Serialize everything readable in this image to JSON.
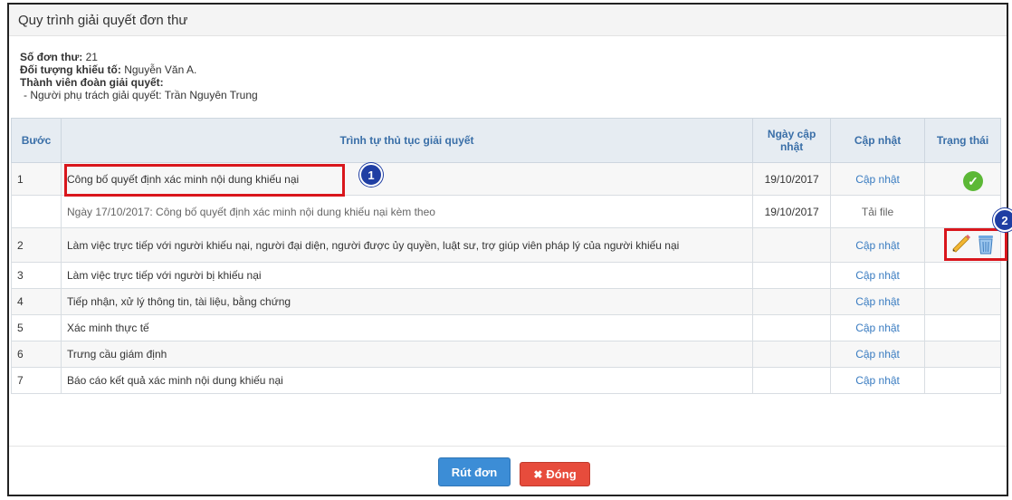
{
  "dialog": {
    "title": "Quy trình giải quyết đơn thư"
  },
  "info": {
    "so_don_thu_label": "Số đơn thư:",
    "so_don_thu_value": "21",
    "doi_tuong_label": "Đối tượng khiếu tố:",
    "doi_tuong_value": "Nguyễn Văn A.",
    "thanh_vien_label": "Thành viên đoàn giải quyết:",
    "phu_trach": "- Người phụ trách giải quyết: Trần Nguyên Trung"
  },
  "table": {
    "headers": [
      "Bước",
      "Trình tự thủ tục giải quyết",
      "Ngày cập nhật",
      "Cập nhật",
      "Trạng thái"
    ],
    "rows": [
      {
        "step": "1",
        "procedure": "Công bố quyết định xác minh nội dung khiếu nại",
        "date": "19/10/2017",
        "action": "Cập nhật",
        "status": "done"
      },
      {
        "step": "",
        "procedure": "Ngày 17/10/2017: Công bố quyết định xác minh nội dung khiếu nại kèm theo",
        "date": "19/10/2017",
        "action": "Tải file",
        "status": "edit-delete"
      },
      {
        "step": "2",
        "procedure": "Làm việc trực tiếp với người khiếu nại, người đại diện, người được ủy quyền, luật sư, trợ giúp viên pháp lý của người khiếu nại",
        "date": "",
        "action": "Cập nhật",
        "status": ""
      },
      {
        "step": "3",
        "procedure": "Làm việc trực tiếp với người bị khiếu nại",
        "date": "",
        "action": "Cập nhật",
        "status": ""
      },
      {
        "step": "4",
        "procedure": "Tiếp nhận, xử lý thông tin, tài liệu, bằng chứng",
        "date": "",
        "action": "Cập nhật",
        "status": ""
      },
      {
        "step": "5",
        "procedure": "Xác minh thực tế",
        "date": "",
        "action": "Cập nhật",
        "status": ""
      },
      {
        "step": "6",
        "procedure": "Trưng cầu giám định",
        "date": "",
        "action": "Cập nhật",
        "status": ""
      },
      {
        "step": "7",
        "procedure": "Báo cáo kết quả xác minh nội dung khiếu nại",
        "date": "",
        "action": "Cập nhật",
        "status": ""
      }
    ]
  },
  "annotations": {
    "badge1": "1",
    "badge2": "2"
  },
  "buttons": {
    "rut_don": "Rút đơn",
    "dong": "Đóng"
  },
  "colors": {
    "link": "#3a7cc1",
    "primary": "#3c8dd6",
    "danger": "#e74c3c",
    "highlight": "#d9161c",
    "badge": "#1f3ea3",
    "success": "#5cb836"
  }
}
